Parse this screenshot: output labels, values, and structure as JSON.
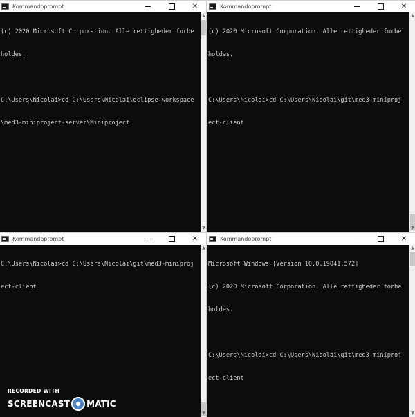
{
  "windows": [
    {
      "title": "Kommandoprompt",
      "lines": [
        "(c) 2020 Microsoft Corporation. Alle rettigheder forbe",
        "holdes.",
        "",
        "C:\\Users\\Nicolai>cd C:\\Users\\Nicolai\\eclipse-workspace",
        "\\med3-miniproject-server\\Miniproject"
      ]
    },
    {
      "title": "Kommandoprompt",
      "lines": [
        "(c) 2020 Microsoft Corporation. Alle rettigheder forbe",
        "holdes.",
        "",
        "C:\\Users\\Nicolai>cd C:\\Users\\Nicolai\\git\\med3-miniproj",
        "ect-client"
      ]
    },
    {
      "title": "Kommandoprompt",
      "lines": [
        "C:\\Users\\Nicolai>cd C:\\Users\\Nicolai\\git\\med3-miniproj",
        "ect-client"
      ]
    },
    {
      "title": "Kommandoprompt",
      "lines": [
        "Microsoft Windows [Version 10.0.19041.572]",
        "(c) 2020 Microsoft Corporation. Alle rettigheder forbe",
        "holdes.",
        "",
        "C:\\Users\\Nicolai>cd C:\\Users\\Nicolai\\git\\med3-miniproj",
        "ect-client"
      ]
    }
  ],
  "watermark": {
    "top": "RECORDED WITH",
    "left": "SCREENCAST",
    "right": "MATIC"
  },
  "colors": {
    "console_bg": "#0c0c0c",
    "console_text": "#cccccc",
    "titlebar_bg": "#ffffff",
    "scrollbar_bg": "#f0f0f0"
  }
}
